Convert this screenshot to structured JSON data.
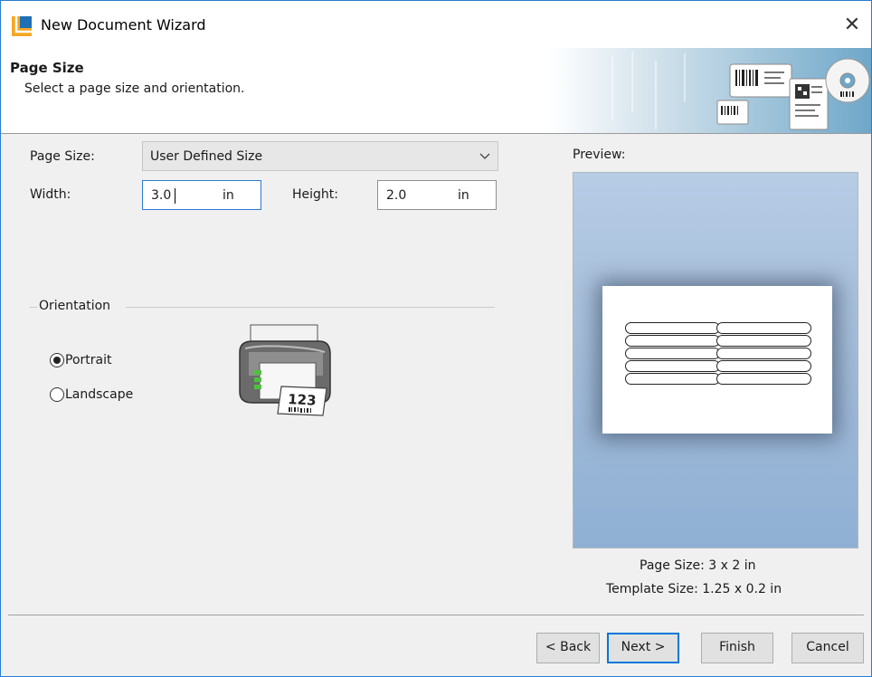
{
  "window": {
    "title": "New Document Wizard",
    "app_icon": "app-logo-icon",
    "close_icon": "close-icon"
  },
  "header": {
    "title": "Page Size",
    "subtitle": "Select a page size and orientation.",
    "banner_icon": "barcode-labels-banner-icon"
  },
  "form": {
    "page_size_label": "Page Size:",
    "page_size_value": "User Defined Size",
    "width_label": "Width:",
    "width_value": "3.0",
    "width_unit": "in",
    "height_label": "Height:",
    "height_value": "2.0",
    "height_unit": "in"
  },
  "orientation": {
    "group_label": "Orientation",
    "options": [
      {
        "label": "Portrait",
        "selected": true
      },
      {
        "label": "Landscape",
        "selected": false
      }
    ],
    "printer_icon": "label-printer-icon",
    "printer_label_text": "123"
  },
  "preview": {
    "label": "Preview:",
    "label_rows": 5,
    "label_columns": 2,
    "page_size_text": "Page Size:  3 x 2 in",
    "template_size_text": "Template Size:  1.25 x 0.2 in"
  },
  "buttons": {
    "back": "< Back",
    "next": "Next >",
    "finish": "Finish",
    "cancel": "Cancel"
  },
  "colors": {
    "accent": "#0078d7",
    "preview_bg": "#a3bcd9",
    "logo_orange": "#f5a623",
    "logo_blue": "#1f6fb5"
  }
}
